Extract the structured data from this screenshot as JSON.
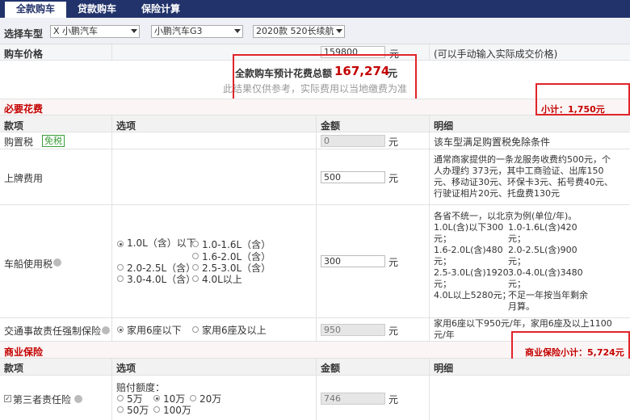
{
  "tabs": [
    "全款购车",
    "贷款购车",
    "保险计算"
  ],
  "selector": {
    "label": "选择车型",
    "brand": "X 小鹏汽车",
    "model": "小鹏汽车G3",
    "version": "2020款 520长续航"
  },
  "price": {
    "label": "购车价格",
    "value": "159800",
    "unit": "元",
    "note": "(可以手动输入实际成交价格)"
  },
  "total": {
    "label": "全款购车预计花费总额",
    "value": "167,274",
    "unit": "元",
    "note": "此结果仅供参考，实际费用以当地缴费为准"
  },
  "required": {
    "title": "必要花费",
    "subtotal": "小计：1,750元"
  },
  "headers": [
    "款项",
    "选项",
    "金额",
    "明细"
  ],
  "purchase_tax": {
    "label": "购置税",
    "badge": "免税",
    "value": "0",
    "unit": "元",
    "detail": "该车型满足购置税免除条件"
  },
  "registration": {
    "label": "上牌费用",
    "value": "500",
    "unit": "元",
    "detail": [
      "通常商家提供的一条龙服务收费约500元，个",
      "人办理约 373元，其中工商验证、出库150",
      "元、移动证30元、环保卡3元、拓号费40元、",
      "行驶证相片20元、托盘费130元"
    ]
  },
  "vehicle_tax": {
    "label": "车船使用税",
    "options": [
      "1.0L（含）以下",
      "1.0-1.6L（含）",
      "1.6-2.0L（含）",
      "2.0-2.5L（含）",
      "2.5-3.0L（含）",
      "3.0-4.0L（含）",
      "4.0L以上"
    ],
    "value": "300",
    "unit": "元",
    "detail_left": [
      "各省不统一，以北京为例(单位/年)。",
      "1.0L(含)以下300",
      "元；",
      "1.6-2.0L(含)480",
      "元；",
      "2.5-3.0L(含)1920",
      "元；",
      "4.0L以上5280元；"
    ],
    "detail_right": [
      "1.0-1.6L(含)420",
      "元；",
      "2.0-2.5L(含)900",
      "元；",
      "3.0-4.0L(含)3480",
      "元；",
      "不足一年按当年剩余",
      "月算。"
    ]
  },
  "compulsory": {
    "label": "交通事故责任强制保险",
    "options": [
      "家用6座以下",
      "家用6座及以上"
    ],
    "value": "950",
    "unit": "元",
    "detail": [
      "家用6座以下950元/年，家用6座及以上1100",
      "元/年"
    ]
  },
  "commercial": {
    "title": "商业保险",
    "subtotal": "商业保险小计：5,724元"
  },
  "third_party": {
    "label": "第三者责任险",
    "limit_label": "赔付额度：",
    "options": [
      "5万",
      "10万",
      "20万",
      "50万",
      "100万"
    ],
    "value": "746",
    "unit": "元"
  },
  "colors": {
    "tab_bar": "#22336b",
    "accent_red": "#c40000",
    "highlight_box": "#e0242a",
    "badge_green": "#3a9c3a"
  }
}
